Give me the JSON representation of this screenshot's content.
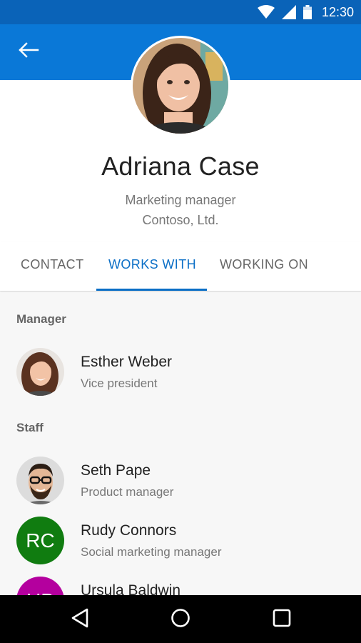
{
  "status_bar": {
    "time": "12:30",
    "icons": [
      "wifi-icon",
      "signal-icon",
      "battery-icon"
    ]
  },
  "app_bar": {
    "back_icon": "back-arrow-icon",
    "color": "#0a78d7"
  },
  "profile": {
    "name": "Adriana Case",
    "title": "Marketing manager",
    "company": "Contoso, Ltd."
  },
  "tabs": [
    {
      "label": "CONTACT",
      "active": false
    },
    {
      "label": "WORKS WITH",
      "active": true
    },
    {
      "label": "WORKING ON",
      "active": false
    }
  ],
  "sections": {
    "manager": {
      "header": "Manager",
      "people": [
        {
          "name": "Esther Weber",
          "role": "Vice president",
          "avatar": "photo"
        }
      ]
    },
    "staff": {
      "header": "Staff",
      "people": [
        {
          "name": "Seth Pape",
          "role": "Product manager",
          "avatar": "photo"
        },
        {
          "name": "Rudy Connors",
          "role": "Social marketing manager",
          "avatar": "initials",
          "initials": "RC",
          "color": "#107c10"
        },
        {
          "name": "Ursula Baldwin",
          "role": "",
          "avatar": "initials",
          "initials": "UB",
          "color": "#b4009e"
        }
      ]
    }
  },
  "nav_bar": {
    "icons": [
      "back-triangle-icon",
      "home-circle-icon",
      "recents-square-icon"
    ]
  },
  "colors": {
    "accent": "#0a6ec6",
    "status_bar": "#0a63b8"
  }
}
